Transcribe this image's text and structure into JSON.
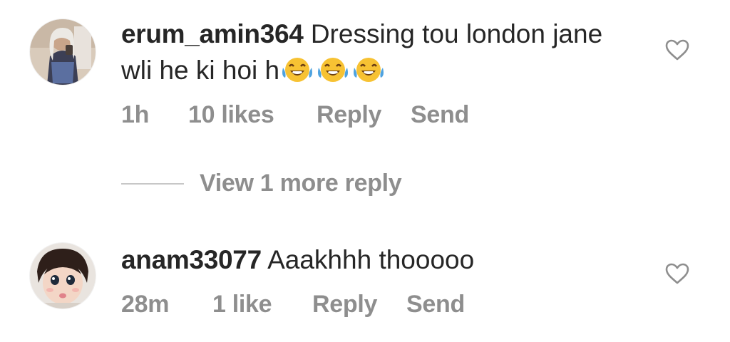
{
  "comments": [
    {
      "username": "erum_amin364",
      "text": "Dressing tou london jane wli he ki hoi h",
      "emojis": [
        "face-with-tears-of-joy",
        "face-with-tears-of-joy",
        "face-with-tears-of-joy"
      ],
      "time": "1h",
      "likes": "10 likes",
      "reply_label": "Reply",
      "send_label": "Send",
      "like_icon": "heart-outline-icon"
    },
    {
      "username": "anam33077",
      "text": "Aaakhhh thooooo",
      "time": "28m",
      "likes": "1 like",
      "reply_label": "Reply",
      "send_label": "Send",
      "like_icon": "heart-outline-icon"
    }
  ],
  "view_more_replies": "View 1 more reply",
  "colors": {
    "text_primary": "#262626",
    "text_secondary": "#8e8e8e",
    "divider": "#c7c7c7",
    "background": "#ffffff"
  }
}
